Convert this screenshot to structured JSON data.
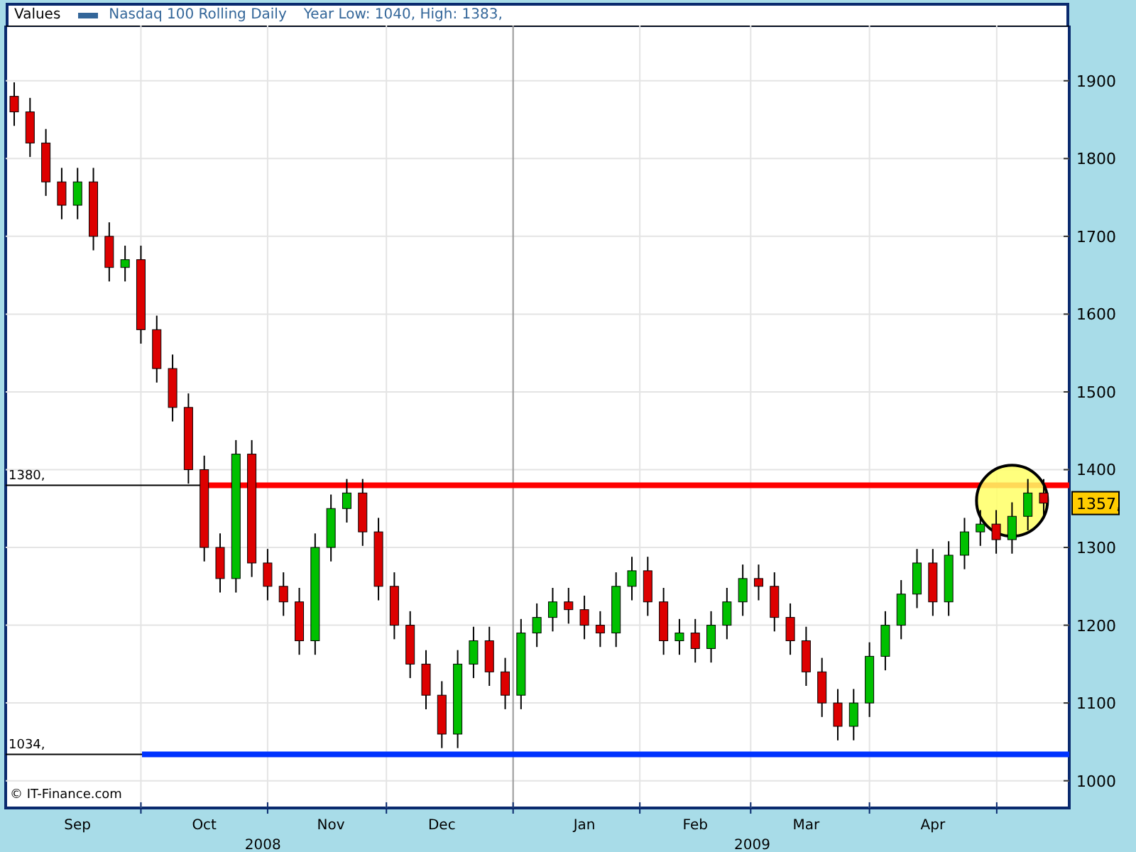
{
  "header": {
    "label": "Values",
    "summary": "Year Low: 1040, High: 1383,"
  },
  "chart_data": {
    "type": "candlestick",
    "title": "Nasdaq 100 Rolling Daily",
    "ylim": [
      965,
      1971
    ],
    "yticks": [
      1000,
      1100,
      1200,
      1300,
      1400,
      1500,
      1600,
      1700,
      1800,
      1900
    ],
    "grid": true,
    "categories": [
      null,
      null,
      null,
      null,
      "Sep",
      null,
      null,
      null,
      null,
      null,
      null,
      null,
      "Oct",
      null,
      null,
      null,
      null,
      null,
      null,
      null,
      "Nov",
      null,
      null,
      null,
      null,
      null,
      null,
      "Dec",
      null,
      null,
      null,
      null,
      null,
      null,
      null,
      null,
      "Jan",
      null,
      null,
      null,
      null,
      null,
      null,
      "Feb",
      null,
      null,
      null,
      null,
      null,
      null,
      "Mar",
      null,
      null,
      null,
      null,
      null,
      null,
      null,
      "Apr",
      null,
      null,
      null,
      null,
      null,
      null,
      null
    ],
    "ohlc": [
      [
        1880,
        1898,
        1842,
        1860
      ],
      [
        1860,
        1878,
        1802,
        1820
      ],
      [
        1820,
        1838,
        1752,
        1770
      ],
      [
        1770,
        1788,
        1722,
        1740
      ],
      [
        1740,
        1788,
        1722,
        1770
      ],
      [
        1770,
        1788,
        1682,
        1700
      ],
      [
        1700,
        1718,
        1642,
        1660
      ],
      [
        1660,
        1688,
        1642,
        1670
      ],
      [
        1670,
        1688,
        1562,
        1580
      ],
      [
        1580,
        1598,
        1512,
        1530
      ],
      [
        1530,
        1548,
        1462,
        1480
      ],
      [
        1480,
        1498,
        1382,
        1400
      ],
      [
        1400,
        1418,
        1282,
        1300
      ],
      [
        1300,
        1318,
        1242,
        1260
      ],
      [
        1260,
        1438,
        1242,
        1420
      ],
      [
        1420,
        1438,
        1262,
        1280
      ],
      [
        1280,
        1298,
        1232,
        1250
      ],
      [
        1250,
        1268,
        1212,
        1230
      ],
      [
        1230,
        1248,
        1162,
        1180
      ],
      [
        1180,
        1318,
        1162,
        1300
      ],
      [
        1300,
        1368,
        1282,
        1350
      ],
      [
        1350,
        1388,
        1332,
        1370
      ],
      [
        1370,
        1388,
        1302,
        1320
      ],
      [
        1320,
        1338,
        1232,
        1250
      ],
      [
        1250,
        1268,
        1182,
        1200
      ],
      [
        1200,
        1218,
        1132,
        1150
      ],
      [
        1150,
        1168,
        1092,
        1110
      ],
      [
        1110,
        1128,
        1042,
        1060
      ],
      [
        1060,
        1168,
        1042,
        1150
      ],
      [
        1150,
        1198,
        1132,
        1180
      ],
      [
        1180,
        1198,
        1122,
        1140
      ],
      [
        1140,
        1158,
        1092,
        1110
      ],
      [
        1110,
        1208,
        1092,
        1190
      ],
      [
        1190,
        1228,
        1172,
        1210
      ],
      [
        1210,
        1248,
        1192,
        1230
      ],
      [
        1230,
        1248,
        1202,
        1220
      ],
      [
        1220,
        1238,
        1182,
        1200
      ],
      [
        1200,
        1218,
        1172,
        1190
      ],
      [
        1190,
        1268,
        1172,
        1250
      ],
      [
        1250,
        1288,
        1232,
        1270
      ],
      [
        1270,
        1288,
        1212,
        1230
      ],
      [
        1230,
        1248,
        1162,
        1180
      ],
      [
        1180,
        1208,
        1162,
        1190
      ],
      [
        1190,
        1208,
        1152,
        1170
      ],
      [
        1170,
        1218,
        1152,
        1200
      ],
      [
        1200,
        1248,
        1182,
        1230
      ],
      [
        1230,
        1278,
        1212,
        1260
      ],
      [
        1260,
        1278,
        1232,
        1250
      ],
      [
        1250,
        1268,
        1192,
        1210
      ],
      [
        1210,
        1228,
        1162,
        1180
      ],
      [
        1180,
        1198,
        1122,
        1140
      ],
      [
        1140,
        1158,
        1082,
        1100
      ],
      [
        1100,
        1118,
        1052,
        1070
      ],
      [
        1070,
        1118,
        1052,
        1100
      ],
      [
        1100,
        1178,
        1082,
        1160
      ],
      [
        1160,
        1218,
        1142,
        1200
      ],
      [
        1200,
        1258,
        1182,
        1240
      ],
      [
        1240,
        1298,
        1222,
        1280
      ],
      [
        1280,
        1298,
        1212,
        1230
      ],
      [
        1230,
        1308,
        1212,
        1290
      ],
      [
        1290,
        1338,
        1272,
        1320
      ],
      [
        1320,
        1348,
        1302,
        1330
      ],
      [
        1330,
        1348,
        1292,
        1310
      ],
      [
        1310,
        1358,
        1292,
        1340
      ],
      [
        1340,
        1388,
        1322,
        1370
      ],
      [
        1370,
        1388,
        1339,
        1357
      ]
    ],
    "ref_lines": [
      {
        "axis": "y",
        "value": 1380,
        "label": "1380,",
        "color": "#ff0000"
      },
      {
        "axis": "y",
        "value": 1034,
        "label": "1034,",
        "color": "#0033ff"
      }
    ]
  },
  "years": [
    "2008",
    "2009"
  ],
  "last_price": "1357,",
  "copyright": "© IT-Finance.com"
}
